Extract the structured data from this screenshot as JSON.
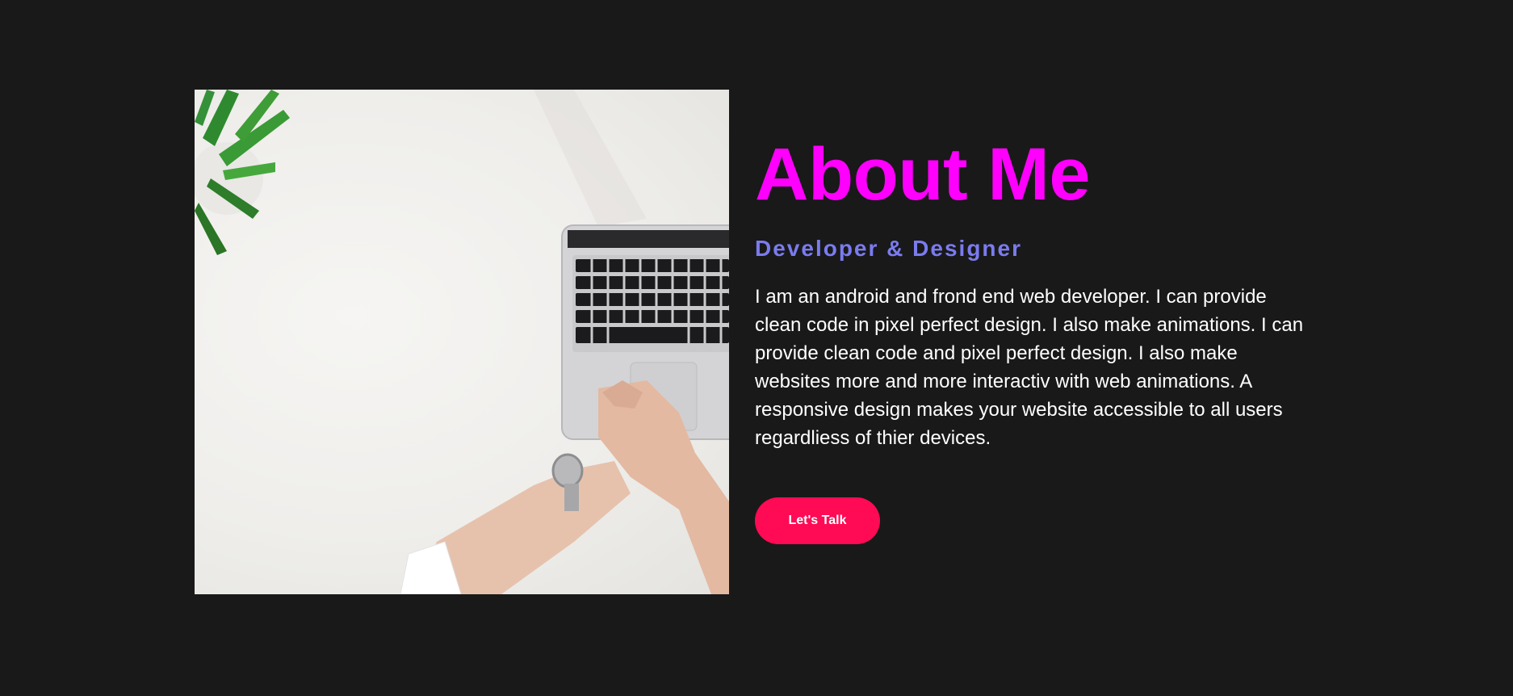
{
  "about": {
    "title": "About Me",
    "subtitle": "Developer & Designer",
    "bio": "I am an android and frond end web developer. I can provide clean code in pixel perfect design. I also make animations. I can provide clean code and pixel perfect design. I also make websites more and more interactiv with web animations. A responsive design makes your website accessible to all users regardliess of thier devices.",
    "button_label": "Let's Talk"
  },
  "colors": {
    "background": "#191919",
    "title": "#ff00ff",
    "subtitle": "#7b7bef",
    "text": "#ffffff",
    "button": "#ff0a54"
  }
}
